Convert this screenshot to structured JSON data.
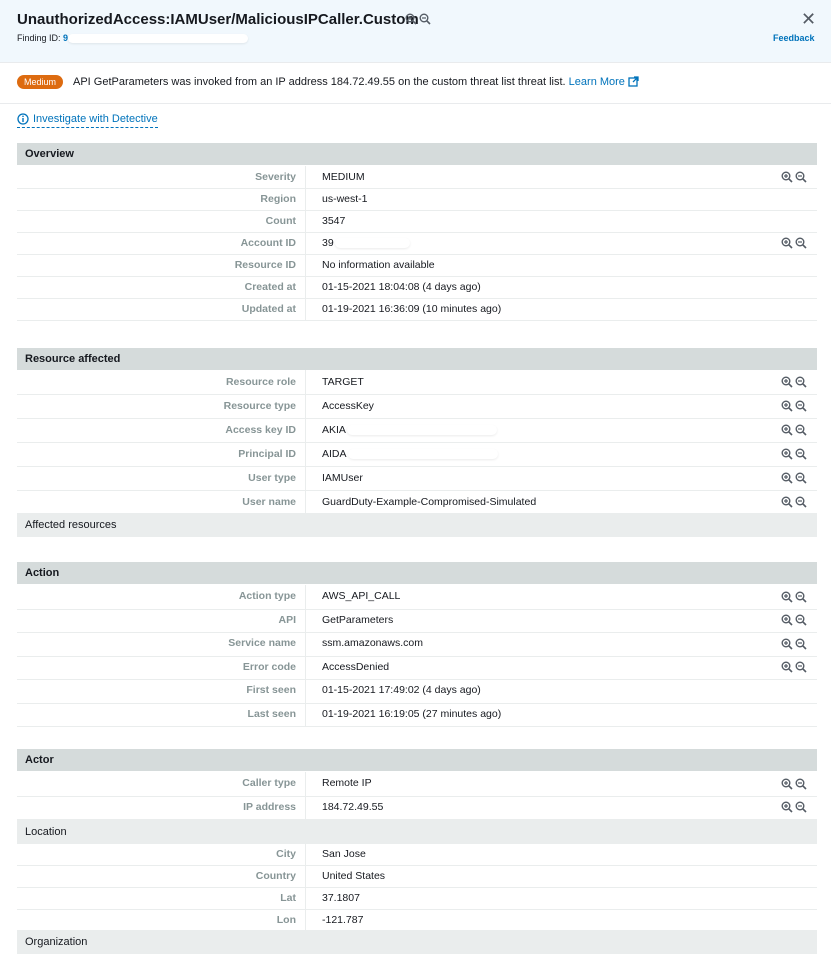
{
  "header": {
    "title": "UnauthorizedAccess:IAMUser/MaliciousIPCaller.Custom",
    "finding_id_label": "Finding ID:",
    "finding_id_value": "9",
    "close_symbol": "✕",
    "feedback": "Feedback"
  },
  "banner": {
    "severity_badge": "Medium",
    "message": "API GetParameters was invoked from an IP address 184.72.49.55 on the custom threat list threat list.",
    "learn_more": "Learn More"
  },
  "investigate": "Investigate with Detective",
  "sections": {
    "overview": {
      "title": "Overview",
      "rows": [
        {
          "label": "Severity",
          "value": "MEDIUM"
        },
        {
          "label": "Region",
          "value": "us-west-1"
        },
        {
          "label": "Count",
          "value": "3547"
        },
        {
          "label": "Account ID",
          "value": "39"
        },
        {
          "label": "Resource ID",
          "value": "No information available"
        },
        {
          "label": "Created at",
          "value": "01-15-2021 18:04:08 (4 days ago)"
        },
        {
          "label": "Updated at",
          "value": "01-19-2021 16:36:09 (10 minutes ago)"
        }
      ]
    },
    "resource": {
      "title": "Resource affected",
      "rows": [
        {
          "label": "Resource role",
          "value": "TARGET"
        },
        {
          "label": "Resource type",
          "value": "AccessKey"
        },
        {
          "label": "Access key ID",
          "value": "AKIA"
        },
        {
          "label": "Principal ID",
          "value": "AIDA"
        },
        {
          "label": "User type",
          "value": "IAMUser"
        },
        {
          "label": "User name",
          "value": "GuardDuty-Example-Compromised-Simulated"
        }
      ],
      "sub": "Affected resources"
    },
    "action": {
      "title": "Action",
      "rows": [
        {
          "label": "Action type",
          "value": "AWS_API_CALL"
        },
        {
          "label": "API",
          "value": "GetParameters"
        },
        {
          "label": "Service name",
          "value": "ssm.amazonaws.com"
        },
        {
          "label": "Error code",
          "value": "AccessDenied"
        },
        {
          "label": "First seen",
          "value": "01-15-2021 17:49:02 (4 days ago)"
        },
        {
          "label": "Last seen",
          "value": "01-19-2021 16:19:05 (27 minutes ago)"
        }
      ]
    },
    "actor": {
      "title": "Actor",
      "rows": [
        {
          "label": "Caller type",
          "value": "Remote IP"
        },
        {
          "label": "IP address",
          "value": "184.72.49.55"
        }
      ],
      "location_title": "Location",
      "location_rows": [
        {
          "label": "City",
          "value": "San Jose"
        },
        {
          "label": "Country",
          "value": "United States"
        },
        {
          "label": "Lat",
          "value": "37.1807"
        },
        {
          "label": "Lon",
          "value": "-121.787"
        }
      ],
      "organization_title": "Organization"
    }
  },
  "colors": {
    "header_bg": "#f1f8fd",
    "link": "#0073bb",
    "severity_medium": "#dd6b10",
    "section_header_bg": "#d5dbdb",
    "subsection_bg": "#eaeded",
    "label_gray": "#879596"
  },
  "icons": [
    "zoom-in-icon",
    "zoom-out-icon",
    "close-icon",
    "external-link-icon",
    "info-icon"
  ]
}
